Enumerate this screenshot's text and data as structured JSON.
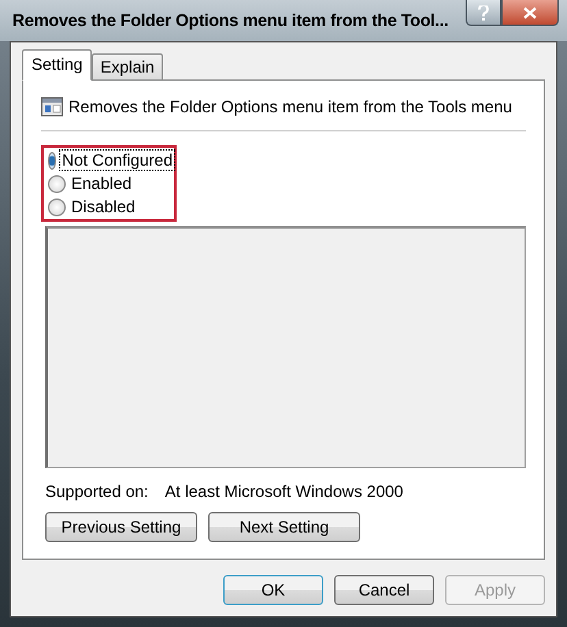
{
  "window": {
    "title": "Removes the Folder Options menu item from the Tool..."
  },
  "tabs": [
    {
      "label": "Setting",
      "selected": true
    },
    {
      "label": "Explain",
      "selected": false
    }
  ],
  "policy": {
    "title": "Removes the Folder Options menu item from the Tools menu"
  },
  "options": [
    {
      "label": "Not Configured",
      "selected": true,
      "focused": true
    },
    {
      "label": "Enabled",
      "selected": false,
      "focused": false
    },
    {
      "label": "Disabled",
      "selected": false,
      "focused": false
    }
  ],
  "supported": {
    "label": "Supported on:",
    "value": "At least Microsoft Windows 2000"
  },
  "nav_buttons": [
    "Previous Setting",
    "Next Setting"
  ],
  "buttons": [
    {
      "label": "OK",
      "default": true,
      "disabled": false
    },
    {
      "label": "Cancel",
      "default": false,
      "disabled": false
    },
    {
      "label": "Apply",
      "default": false,
      "disabled": true
    }
  ]
}
